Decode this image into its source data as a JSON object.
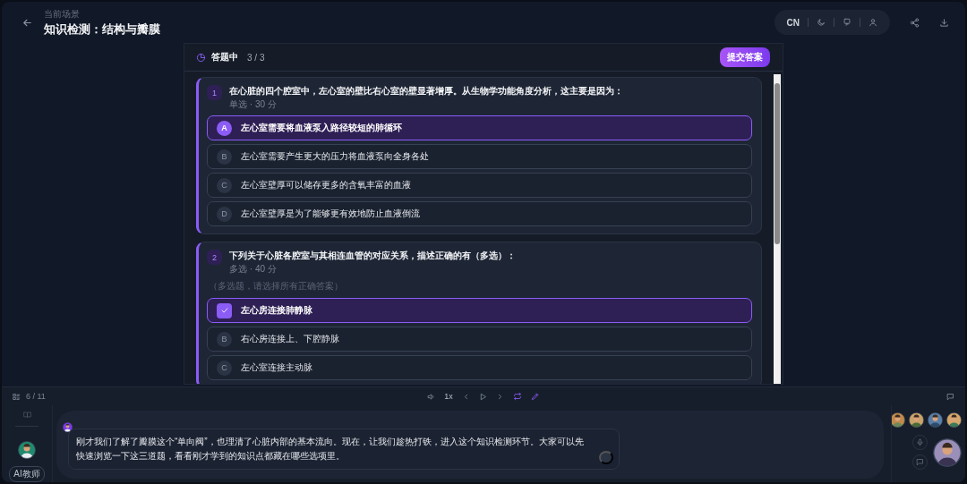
{
  "header": {
    "breadcrumb": "当前场景",
    "title": "知识检测：结构与瓣膜",
    "language": "CN"
  },
  "quiz": {
    "status": "答题中",
    "progress": "3 / 3",
    "submit": "提交答案",
    "questions": [
      {
        "number": "1",
        "kind": "single",
        "text": "在心脏的四个腔室中，左心室的壁比右心室的壁显著增厚。从生物学功能角度分析，这主要是因为：",
        "meta": "单选 · 30 分",
        "options": [
          {
            "letter": "A",
            "text": "左心室需要将血液泵入路径较短的肺循环",
            "selected": true
          },
          {
            "letter": "B",
            "text": "左心室需要产生更大的压力将血液泵向全身各处",
            "selected": false
          },
          {
            "letter": "C",
            "text": "左心室壁厚可以储存更多的含氧丰富的血液",
            "selected": false
          },
          {
            "letter": "D",
            "text": "左心室壁厚是为了能够更有效地防止血液倒流",
            "selected": false
          }
        ]
      },
      {
        "number": "2",
        "kind": "multiple",
        "text": "下列关于心脏各腔室与其相连血管的对应关系，描述正确的有（多选）：",
        "meta": "多选 · 40 分",
        "hint": "（多选题，请选择所有正确答案）",
        "options": [
          {
            "text": "左心房连接肺静脉",
            "selected": true
          },
          {
            "letter": "B",
            "text": "右心房连接上、下腔静脉",
            "selected": false
          },
          {
            "letter": "C",
            "text": "左心室连接主动脉",
            "selected": false
          }
        ]
      }
    ]
  },
  "player": {
    "page": "6 / 11",
    "speed": "1x"
  },
  "chat": {
    "speaker": "AI教师",
    "message": "刚才我们了解了瓣膜这个“单向阀”，也理清了心脏内部的基本流向。现在，让我们趁热打铁，进入这个知识检测环节。大家可以先快速浏览一下这三道题，看看刚才学到的知识点都藏在哪些选项里。"
  }
}
